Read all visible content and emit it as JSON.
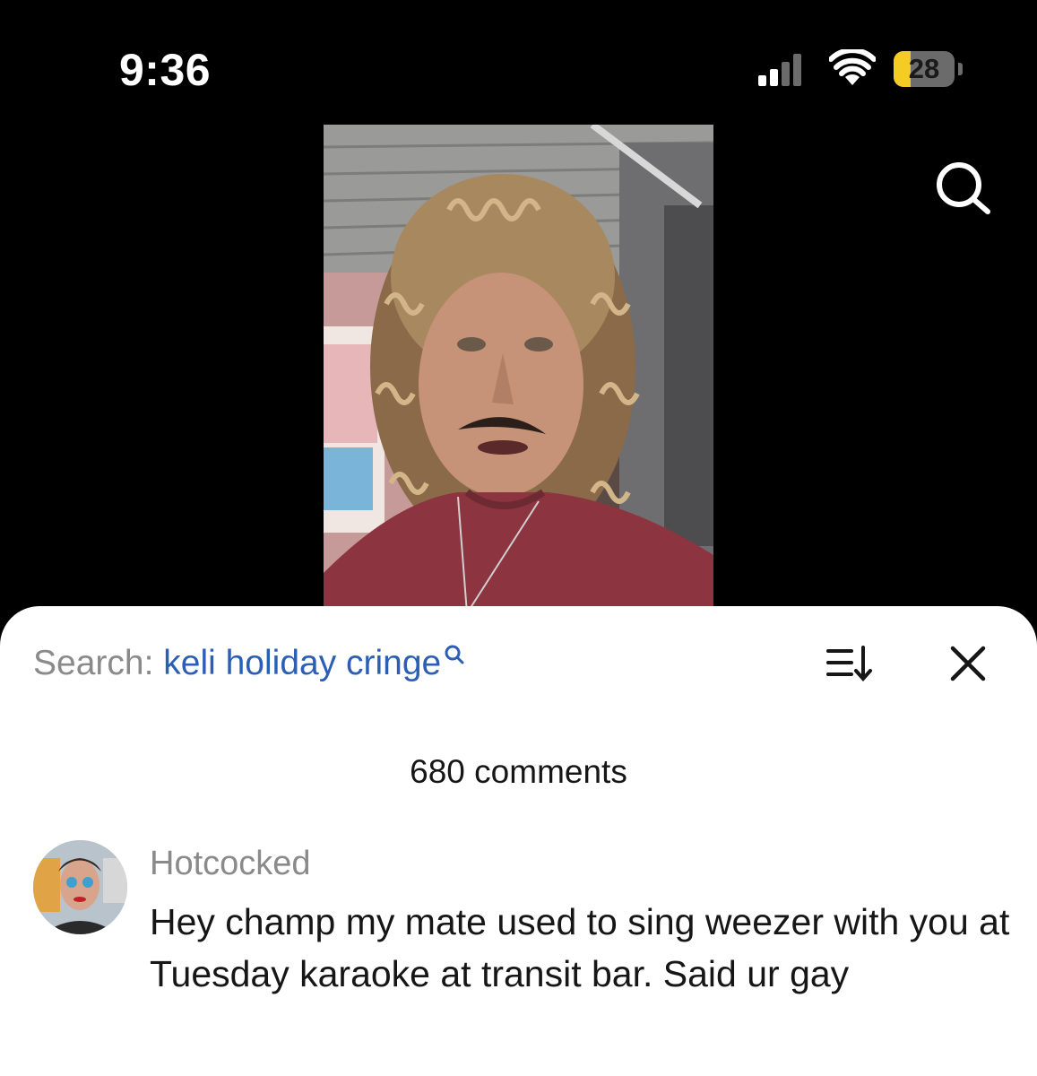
{
  "status_bar": {
    "time": "9:36",
    "battery_level": "28",
    "battery_fraction": 0.28,
    "signal_icon": "cellular-signal-icon",
    "wifi_icon": "wifi-icon",
    "battery_color": "#f5cc24"
  },
  "header": {
    "search_icon": "search-icon"
  },
  "comments_sheet": {
    "search_label": "Search:",
    "search_query": "keli holiday cringe",
    "query_color": "#2b5fb5",
    "sort_icon": "sort-icon",
    "close_icon": "close-icon",
    "count_label": "680 comments"
  },
  "comments": [
    {
      "username": "Hotcocked",
      "text": "Hey champ my mate used to sing weezer with you at Tuesday karaoke at transit bar. Said ur gay"
    }
  ]
}
